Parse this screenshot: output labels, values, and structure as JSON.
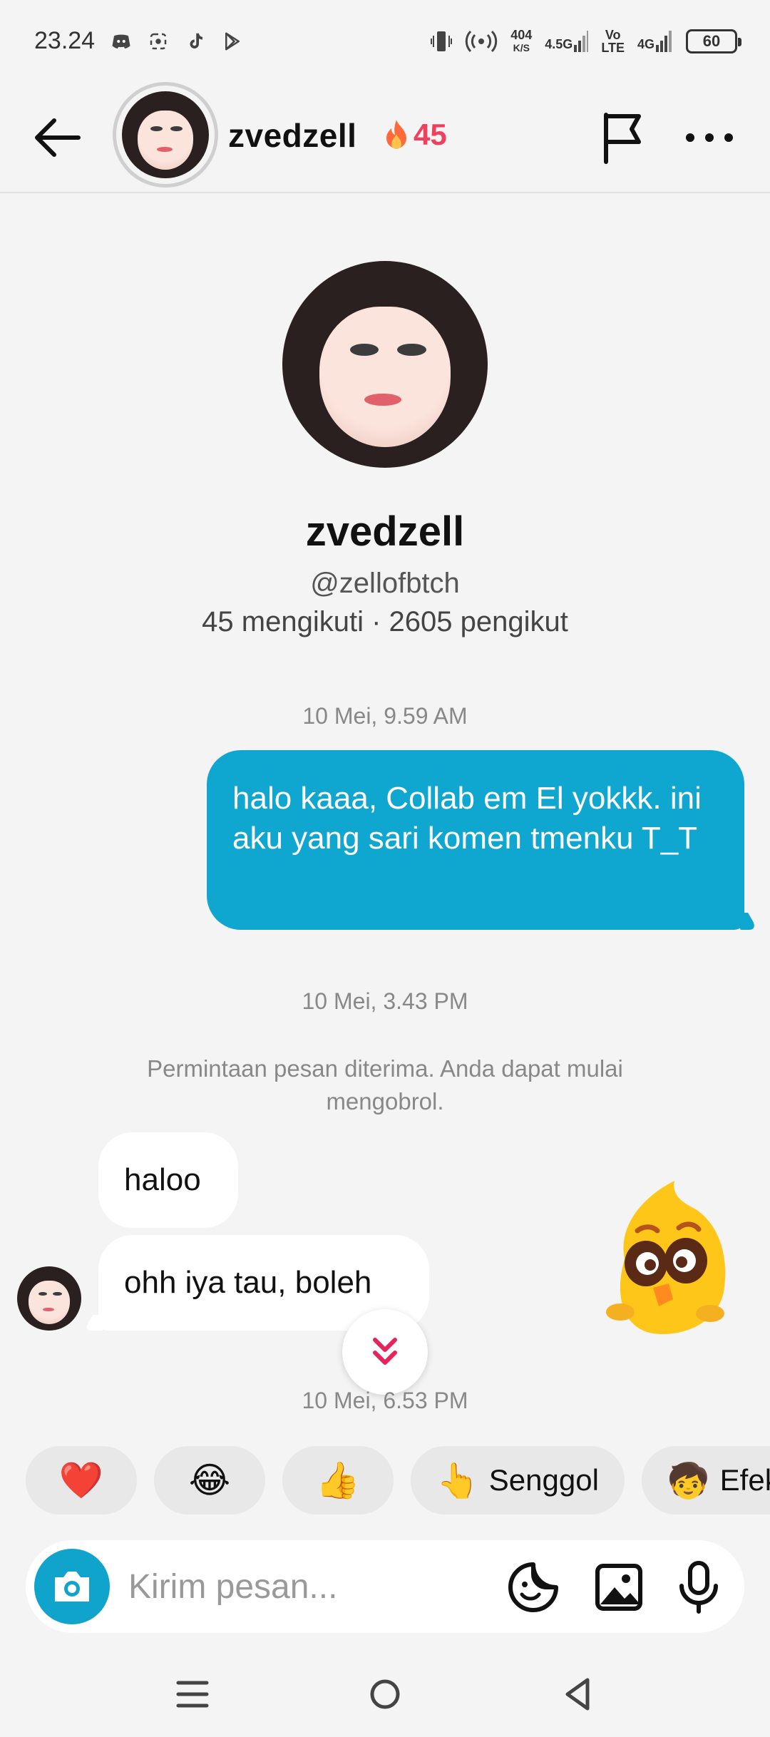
{
  "status_bar": {
    "time": "23.24",
    "speed_value": "404",
    "speed_unit": "K/S",
    "net1_top": "4.5G",
    "volte_top": "Vo",
    "volte_bottom": "LTE",
    "net2_top": "4G",
    "battery": "60"
  },
  "header": {
    "username": "zvedzell",
    "streak_count": "45"
  },
  "profile": {
    "display_name": "zvedzell",
    "handle": "@zellofbtch",
    "stats": "45 mengikuti · 2605 pengikut"
  },
  "messages": {
    "timestamp_1": "10 Mei, 9.59 AM",
    "outgoing_1": "halo kaaa, Collab em El yokkk. ini aku yang sari komen tmenku T_T",
    "timestamp_2": "10 Mei, 3.43 PM",
    "system_notice": "Permintaan pesan diterima. Anda dapat mulai mengobrol.",
    "incoming_1": "haloo",
    "incoming_2": "ohh iya tau, boleh",
    "timestamp_3": "10 Mei, 6.53 PM"
  },
  "quick_replies": [
    {
      "label": "",
      "glyph": "❤️"
    },
    {
      "label": "",
      "glyph": "😂"
    },
    {
      "label": "",
      "glyph": "👍"
    },
    {
      "label": "Senggol",
      "glyph": "👆"
    },
    {
      "label": "Efek",
      "glyph": "🧒"
    }
  ],
  "composer": {
    "placeholder": "Kirim pesan..."
  },
  "colors": {
    "accent": "#0fa6cf",
    "streak": "#f0405e"
  }
}
